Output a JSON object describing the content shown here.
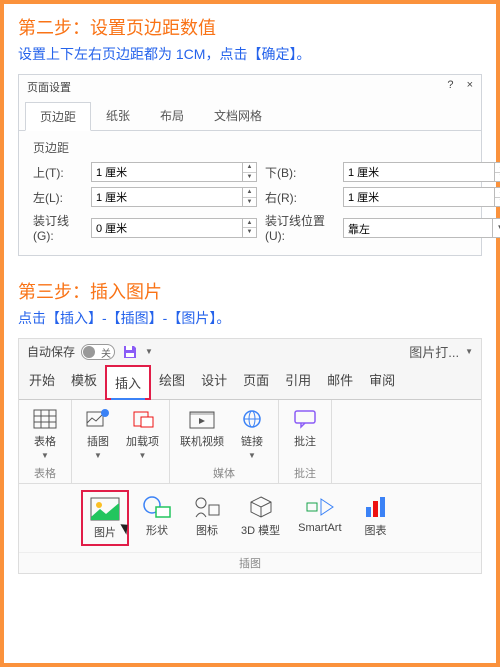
{
  "step2": {
    "title": "第二步：设置页边距数值",
    "desc": "设置上下左右页边距都为 1CM，点击【确定】。"
  },
  "dialog": {
    "title": "页面设置",
    "help": "?",
    "close": "×",
    "tabs": [
      "页边距",
      "纸张",
      "布局",
      "文档网格"
    ],
    "section": "页边距",
    "fields": {
      "top": {
        "label": "上(T):",
        "value": "1 厘米"
      },
      "bottom": {
        "label": "下(B):",
        "value": "1 厘米"
      },
      "left": {
        "label": "左(L):",
        "value": "1 厘米"
      },
      "right": {
        "label": "右(R):",
        "value": "1 厘米"
      },
      "gutter": {
        "label": "装订线(G):",
        "value": "0 厘米"
      },
      "gutterPos": {
        "label": "装订线位置(U):",
        "value": "靠左"
      }
    }
  },
  "step3": {
    "title": "第三步：插入图片",
    "desc": "点击【插入】-【插图】-【图片】。"
  },
  "ribbon": {
    "autosave": "自动保存",
    "toggleState": "关",
    "docName": "图片打...",
    "tabs": [
      "开始",
      "模板",
      "插入",
      "绘图",
      "设计",
      "页面",
      "引用",
      "邮件",
      "审阅"
    ],
    "groups": {
      "tables": {
        "btn": "表格",
        "label": "表格"
      },
      "illus": {
        "btn": "插图",
        "addin": "加载项"
      },
      "media": {
        "video": "联机视频",
        "link": "链接",
        "label": "媒体"
      },
      "comment": {
        "btn": "批注",
        "label": "批注"
      }
    },
    "gallery": {
      "pic": "图片",
      "shape": "形状",
      "icon": "图标",
      "model": "3D 模型",
      "smart": "SmartArt",
      "chart": "图表",
      "label": "插图"
    }
  }
}
